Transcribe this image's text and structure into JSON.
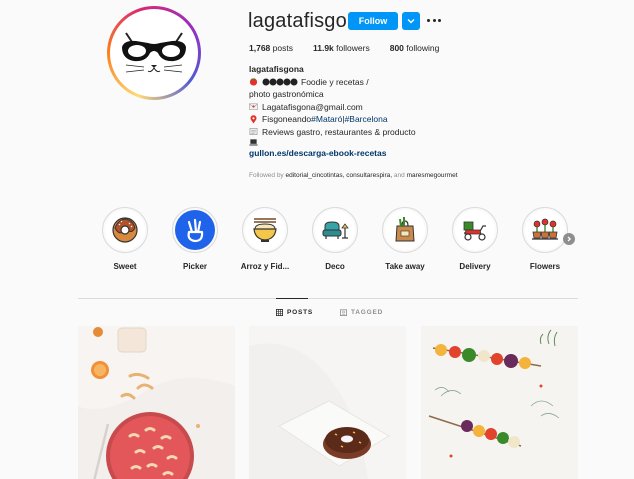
{
  "profile": {
    "username": "lagatafisgona",
    "follow_label": "Follow",
    "stats": {
      "posts_count": "1,768",
      "posts_label": "posts",
      "followers_count": "11.9k",
      "followers_label": "followers",
      "following_count": "800",
      "following_label": "following"
    },
    "bio": {
      "name": "lagatafisgona",
      "line1": "Foodie y recetas /",
      "line2": "photo gastronómica",
      "line3": "Lagatafisgona@gmail.com",
      "line4_text": "Fisgoneando ",
      "line4_hashtag1": "#Mataró",
      "line4_sep": "|",
      "line4_hashtag2": "#Barcelona",
      "line5": "Reviews gastro, restaurantes & producto",
      "link": "gullon.es/descarga-ebook-recetas",
      "followed_by_prefix": "Followed by",
      "followed_by_names": "editorial_cincotintas, consultarespira,",
      "followed_by_and": "and",
      "followed_by_last": "maresmegourmet"
    }
  },
  "highlights": [
    {
      "label": "Sweet",
      "icon": "donut-icon"
    },
    {
      "label": "Picker",
      "icon": "hand-icon"
    },
    {
      "label": "Arroz y Fid...",
      "icon": "rice-bowl-icon"
    },
    {
      "label": "Deco",
      "icon": "armchair-icon"
    },
    {
      "label": "Take away",
      "icon": "bag-icon"
    },
    {
      "label": "Delivery",
      "icon": "scooter-icon"
    },
    {
      "label": "Flowers",
      "icon": "flower-pots-icon"
    }
  ],
  "tabs": {
    "posts": "POSTS",
    "tagged": "TAGGED"
  },
  "colors": {
    "accent": "#0095f6",
    "link": "#00376b",
    "muted": "#8e8e8e"
  }
}
